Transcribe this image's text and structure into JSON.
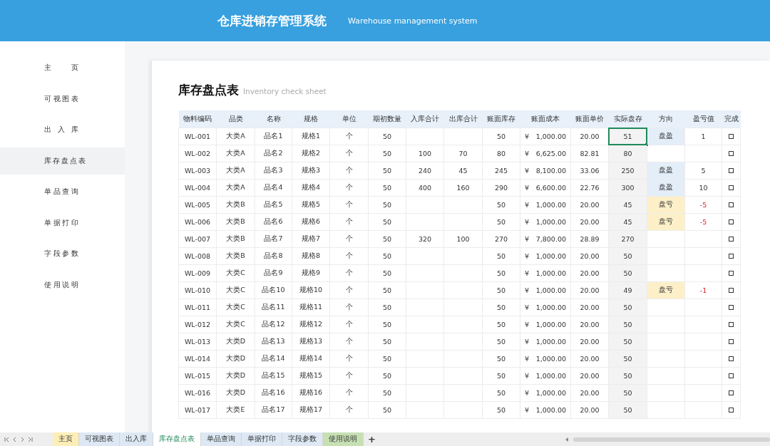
{
  "header": {
    "title": "仓库进销存管理系统",
    "subtitle": "Warehouse management system"
  },
  "sidebar": {
    "items": [
      {
        "label": "主页",
        "selected": false
      },
      {
        "label": "可视图表",
        "selected": false
      },
      {
        "label": "出入库",
        "selected": false
      },
      {
        "label": "库存盘点表",
        "selected": true
      },
      {
        "label": "单品查询",
        "selected": false
      },
      {
        "label": "单据打印",
        "selected": false
      },
      {
        "label": "字段参数",
        "selected": false
      },
      {
        "label": "使用说明",
        "selected": false
      }
    ]
  },
  "sheet": {
    "title": "库存盘点表",
    "subtitle": "Inventory check sheet"
  },
  "table": {
    "columns": [
      "物料编码",
      "品类",
      "名称",
      "规格",
      "单位",
      "期初数量",
      "入库合计",
      "出库合计",
      "账面库存",
      "账面成本",
      "账面单价",
      "实际盘存",
      "方向",
      "盈亏值",
      "完成"
    ],
    "rows": [
      {
        "code": "WL-001",
        "category": "大类A",
        "name": "品名1",
        "spec": "规格1",
        "unit": "个",
        "opening": "50",
        "book": "50",
        "currency": "¥",
        "cost": "1,000.00",
        "price": "20.00",
        "actual": "51",
        "selected": true,
        "direction": "盘盈",
        "kind": "gain",
        "diff": "1",
        "done": false
      },
      {
        "code": "WL-002",
        "category": "大类A",
        "name": "品名2",
        "spec": "规格2",
        "unit": "个",
        "opening": "50",
        "in": "100",
        "out": "70",
        "book": "80",
        "currency": "¥",
        "cost": "6,625.00",
        "price": "82.81",
        "actual": "80",
        "selected": false,
        "kind": "none",
        "done": false
      },
      {
        "code": "WL-003",
        "category": "大类A",
        "name": "品名3",
        "spec": "规格3",
        "unit": "个",
        "opening": "50",
        "in": "240",
        "out": "45",
        "book": "245",
        "currency": "¥",
        "cost": "8,100.00",
        "price": "33.06",
        "actual": "250",
        "selected": false,
        "direction": "盘盈",
        "kind": "gain",
        "diff": "5",
        "done": false
      },
      {
        "code": "WL-004",
        "category": "大类A",
        "name": "品名4",
        "spec": "规格4",
        "unit": "个",
        "opening": "50",
        "in": "400",
        "out": "160",
        "book": "290",
        "currency": "¥",
        "cost": "6,600.00",
        "price": "22.76",
        "actual": "300",
        "selected": false,
        "direction": "盘盈",
        "kind": "gain",
        "diff": "10",
        "done": false
      },
      {
        "code": "WL-005",
        "category": "大类B",
        "name": "品名5",
        "spec": "规格5",
        "unit": "个",
        "opening": "50",
        "book": "50",
        "currency": "¥",
        "cost": "1,000.00",
        "price": "20.00",
        "actual": "45",
        "selected": false,
        "direction": "盘亏",
        "kind": "loss",
        "diff": "-5",
        "done": false
      },
      {
        "code": "WL-006",
        "category": "大类B",
        "name": "品名6",
        "spec": "规格6",
        "unit": "个",
        "opening": "50",
        "book": "50",
        "currency": "¥",
        "cost": "1,000.00",
        "price": "20.00",
        "actual": "45",
        "selected": false,
        "direction": "盘亏",
        "kind": "loss",
        "diff": "-5",
        "done": false
      },
      {
        "code": "WL-007",
        "category": "大类B",
        "name": "品名7",
        "spec": "规格7",
        "unit": "个",
        "opening": "50",
        "in": "320",
        "out": "100",
        "book": "270",
        "currency": "¥",
        "cost": "7,800.00",
        "price": "28.89",
        "actual": "270",
        "selected": false,
        "kind": "none",
        "done": false
      },
      {
        "code": "WL-008",
        "category": "大类B",
        "name": "品名8",
        "spec": "规格8",
        "unit": "个",
        "opening": "50",
        "book": "50",
        "currency": "¥",
        "cost": "1,000.00",
        "price": "20.00",
        "actual": "50",
        "selected": false,
        "kind": "none",
        "done": false
      },
      {
        "code": "WL-009",
        "category": "大类C",
        "name": "品名9",
        "spec": "规格9",
        "unit": "个",
        "opening": "50",
        "book": "50",
        "currency": "¥",
        "cost": "1,000.00",
        "price": "20.00",
        "actual": "50",
        "selected": false,
        "kind": "none",
        "done": false
      },
      {
        "code": "WL-010",
        "category": "大类C",
        "name": "品名10",
        "spec": "规格10",
        "unit": "个",
        "opening": "50",
        "book": "50",
        "currency": "¥",
        "cost": "1,000.00",
        "price": "20.00",
        "actual": "49",
        "selected": false,
        "direction": "盘亏",
        "kind": "loss",
        "diff": "-1",
        "done": false
      },
      {
        "code": "WL-011",
        "category": "大类C",
        "name": "品名11",
        "spec": "规格11",
        "unit": "个",
        "opening": "50",
        "book": "50",
        "currency": "¥",
        "cost": "1,000.00",
        "price": "20.00",
        "actual": "50",
        "selected": false,
        "kind": "none",
        "done": false
      },
      {
        "code": "WL-012",
        "category": "大类C",
        "name": "品名12",
        "spec": "规格12",
        "unit": "个",
        "opening": "50",
        "book": "50",
        "currency": "¥",
        "cost": "1,000.00",
        "price": "20.00",
        "actual": "50",
        "selected": false,
        "kind": "none",
        "done": false
      },
      {
        "code": "WL-013",
        "category": "大类D",
        "name": "品名13",
        "spec": "规格13",
        "unit": "个",
        "opening": "50",
        "book": "50",
        "currency": "¥",
        "cost": "1,000.00",
        "price": "20.00",
        "actual": "50",
        "selected": false,
        "kind": "none",
        "done": false
      },
      {
        "code": "WL-014",
        "category": "大类D",
        "name": "品名14",
        "spec": "规格14",
        "unit": "个",
        "opening": "50",
        "book": "50",
        "currency": "¥",
        "cost": "1,000.00",
        "price": "20.00",
        "actual": "50",
        "selected": false,
        "kind": "none",
        "done": false
      },
      {
        "code": "WL-015",
        "category": "大类D",
        "name": "品名15",
        "spec": "规格15",
        "unit": "个",
        "opening": "50",
        "book": "50",
        "currency": "¥",
        "cost": "1,000.00",
        "price": "20.00",
        "actual": "50",
        "selected": false,
        "kind": "none",
        "done": false
      },
      {
        "code": "WL-016",
        "category": "大类D",
        "name": "品名16",
        "spec": "规格16",
        "unit": "个",
        "opening": "50",
        "book": "50",
        "currency": "¥",
        "cost": "1,000.00",
        "price": "20.00",
        "actual": "50",
        "selected": false,
        "kind": "none",
        "done": false
      },
      {
        "code": "WL-017",
        "category": "大类E",
        "name": "品名17",
        "spec": "规格17",
        "unit": "个",
        "opening": "50",
        "book": "50",
        "currency": "¥",
        "cost": "1,000.00",
        "price": "20.00",
        "actual": "50",
        "selected": false,
        "kind": "none",
        "done": false
      }
    ]
  },
  "sheet_tabs": [
    {
      "label": "主页",
      "selected": false,
      "color": "#fdeeb8"
    },
    {
      "label": "可视图表",
      "selected": false,
      "color": "#dde8f4"
    },
    {
      "label": "出入库",
      "selected": false,
      "color": "#dde8f4"
    },
    {
      "label": "库存盘点表",
      "selected": true,
      "color": "#ffffff"
    },
    {
      "label": "单品查询",
      "selected": false,
      "color": "#dde8f4"
    },
    {
      "label": "单据打印",
      "selected": false,
      "color": "#dde8f4"
    },
    {
      "label": "字段参数",
      "selected": false,
      "color": "#dde8f4"
    },
    {
      "label": "使用说明",
      "selected": false,
      "color": "#c6e0b4"
    }
  ],
  "add_tab": "+"
}
